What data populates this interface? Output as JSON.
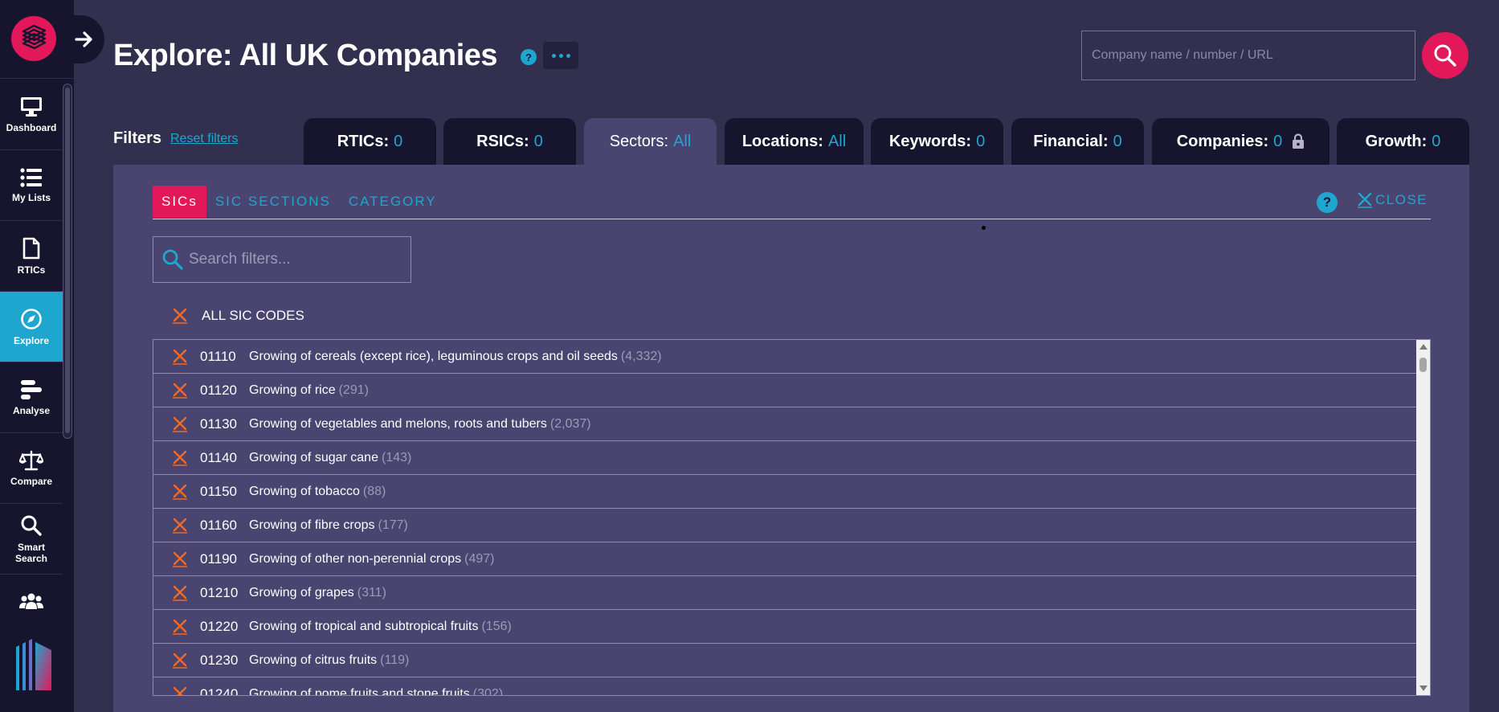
{
  "sidebar": {
    "items": [
      {
        "label": "Dashboard",
        "icon": "monitor-icon"
      },
      {
        "label": "My Lists",
        "icon": "list-icon"
      },
      {
        "label": "RTICs",
        "icon": "document-icon"
      },
      {
        "label": "Explore",
        "icon": "compass-icon",
        "active": true
      },
      {
        "label": "Analyse",
        "icon": "bars-icon"
      },
      {
        "label": "Compare",
        "icon": "scales-icon"
      },
      {
        "label": "Smart Search",
        "icon": "magnifier-icon"
      }
    ]
  },
  "header": {
    "title": "Explore: All UK Companies",
    "help": "?",
    "search_placeholder": "Company name / number / URL"
  },
  "filters": {
    "label": "Filters",
    "reset": "Reset filters",
    "tabs": [
      {
        "label": "RTICs:",
        "value": "0"
      },
      {
        "label": "RSICs:",
        "value": "0"
      },
      {
        "label": "Sectors:",
        "value": "All",
        "active": true
      },
      {
        "label": "Locations:",
        "value": "All"
      },
      {
        "label": "Keywords:",
        "value": "0"
      },
      {
        "label": "Financial:",
        "value": "0"
      },
      {
        "label": "Companies:",
        "value": "0",
        "locked": true
      },
      {
        "label": "Growth:",
        "value": "0"
      }
    ]
  },
  "panel": {
    "sub_tabs": [
      "SICs",
      "SIC SECTIONS",
      "CATEGORY"
    ],
    "help": "?",
    "close": "CLOSE",
    "search_placeholder": "Search filters...",
    "all_label": "ALL SIC CODES",
    "rows": [
      {
        "code": "01110",
        "name": "Growing of cereals (except rice), leguminous crops and oil seeds",
        "count": "(4,332)"
      },
      {
        "code": "01120",
        "name": "Growing of rice",
        "count": "(291)"
      },
      {
        "code": "01130",
        "name": "Growing of vegetables and melons, roots and tubers",
        "count": "(2,037)"
      },
      {
        "code": "01140",
        "name": "Growing of sugar cane",
        "count": "(143)"
      },
      {
        "code": "01150",
        "name": "Growing of tobacco",
        "count": "(88)"
      },
      {
        "code": "01160",
        "name": "Growing of fibre crops",
        "count": "(177)"
      },
      {
        "code": "01190",
        "name": "Growing of other non-perennial crops",
        "count": "(497)"
      },
      {
        "code": "01210",
        "name": "Growing of grapes",
        "count": "(311)"
      },
      {
        "code": "01220",
        "name": "Growing of tropical and subtropical fruits",
        "count": "(156)"
      },
      {
        "code": "01230",
        "name": "Growing of citrus fruits",
        "count": "(119)"
      },
      {
        "code": "01240",
        "name": "Growing of pome fruits and stone fruits",
        "count": "(302)"
      }
    ]
  },
  "colors": {
    "accent": "#1fa6cf",
    "brand": "#e2185b",
    "cross": "#f26a21"
  }
}
